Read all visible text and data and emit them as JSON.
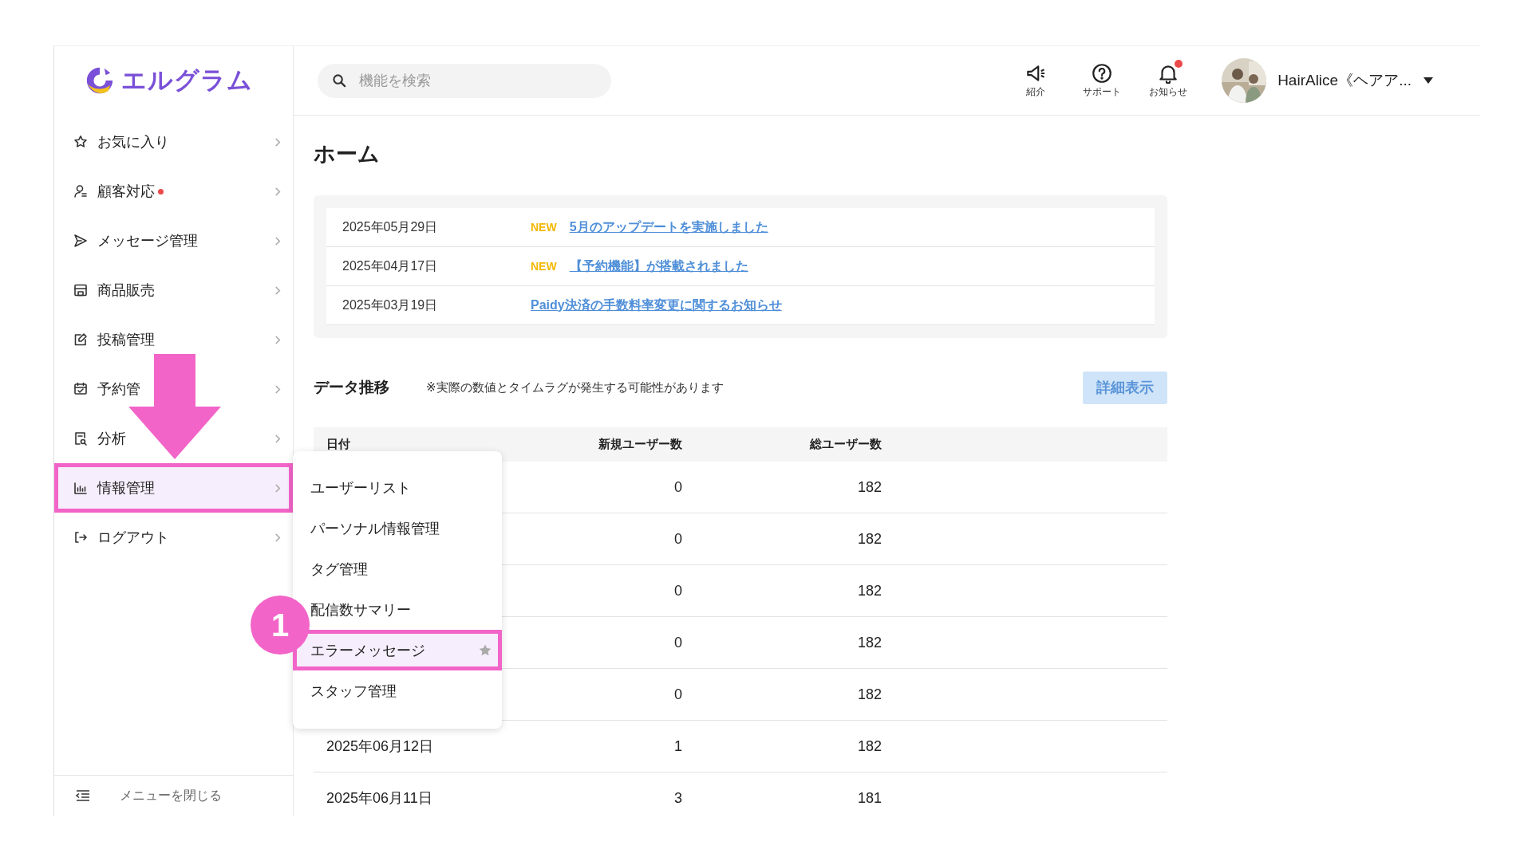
{
  "logo": {
    "text": "エルグラム"
  },
  "search": {
    "placeholder": "機能を検索"
  },
  "header_actions": [
    {
      "kind": "megaphone",
      "label": "紹介",
      "badge": false
    },
    {
      "kind": "help",
      "label": "サポート",
      "badge": false
    },
    {
      "kind": "bell",
      "label": "お知らせ",
      "badge": true
    }
  ],
  "user": {
    "name": "HairAlice《ヘアア..."
  },
  "sidebar": {
    "items": [
      {
        "kind": "star",
        "label": "お気に入り",
        "badge": false,
        "selected": false,
        "highlighted": false
      },
      {
        "kind": "person",
        "label": "顧客対応",
        "badge": true,
        "selected": false,
        "highlighted": false
      },
      {
        "kind": "send",
        "label": "メッセージ管理",
        "badge": false,
        "selected": false,
        "highlighted": false
      },
      {
        "kind": "store",
        "label": "商品販売",
        "badge": false,
        "selected": false,
        "highlighted": false
      },
      {
        "kind": "edit",
        "label": "投稿管理",
        "badge": false,
        "selected": false,
        "highlighted": false
      },
      {
        "kind": "calendar",
        "label": "予約管",
        "badge": false,
        "selected": false,
        "highlighted": false
      },
      {
        "kind": "report",
        "label": "分析",
        "badge": false,
        "selected": false,
        "highlighted": false
      },
      {
        "kind": "chart",
        "label": "情報管理",
        "badge": false,
        "selected": true,
        "highlighted": true
      },
      {
        "kind": "logout",
        "label": "ログアウト",
        "badge": false,
        "selected": false,
        "highlighted": false
      }
    ],
    "close_label": "メニューを閉じる"
  },
  "submenu": {
    "items": [
      {
        "label": "ユーザーリスト",
        "selected": false,
        "highlighted": false
      },
      {
        "label": "パーソナル情報管理",
        "selected": false,
        "highlighted": false
      },
      {
        "label": "タグ管理",
        "selected": false,
        "highlighted": false
      },
      {
        "label": "配信数サマリー",
        "selected": false,
        "highlighted": false
      },
      {
        "label": "エラーメッセージ",
        "selected": true,
        "highlighted": true
      },
      {
        "label": "スタッフ管理",
        "selected": false,
        "highlighted": false
      }
    ]
  },
  "page_title": "ホーム",
  "news": [
    {
      "date": "2025年05月29日",
      "new_label": "NEW",
      "title": "5月のアップデートを実施しました"
    },
    {
      "date": "2025年04月17日",
      "new_label": "NEW",
      "title": "【予約機能】が搭載されました"
    },
    {
      "date": "2025年03月19日",
      "title": "Paidy決済の手数料率変更に関するお知らせ"
    }
  ],
  "data_section": {
    "title": "データ推移",
    "note": "※実際の数値とタイムラグが発生する可能性があります",
    "button": "詳細表示"
  },
  "table": {
    "columns": [
      "日付",
      "新規ユーザー数",
      "総ユーザー数"
    ],
    "rows": [
      {
        "new_users": "0",
        "total_users": "182"
      },
      {
        "new_users": "0",
        "total_users": "182"
      },
      {
        "new_users": "0",
        "total_users": "182"
      },
      {
        "new_users": "0",
        "total_users": "182"
      },
      {
        "new_users": "0",
        "total_users": "182"
      },
      {
        "date": "2025年06月12日",
        "new_users": "1",
        "total_users": "182"
      },
      {
        "date": "2025年06月11日",
        "new_users": "3",
        "total_users": "181"
      }
    ]
  },
  "annotations": {
    "arrow": true,
    "step": "1"
  }
}
